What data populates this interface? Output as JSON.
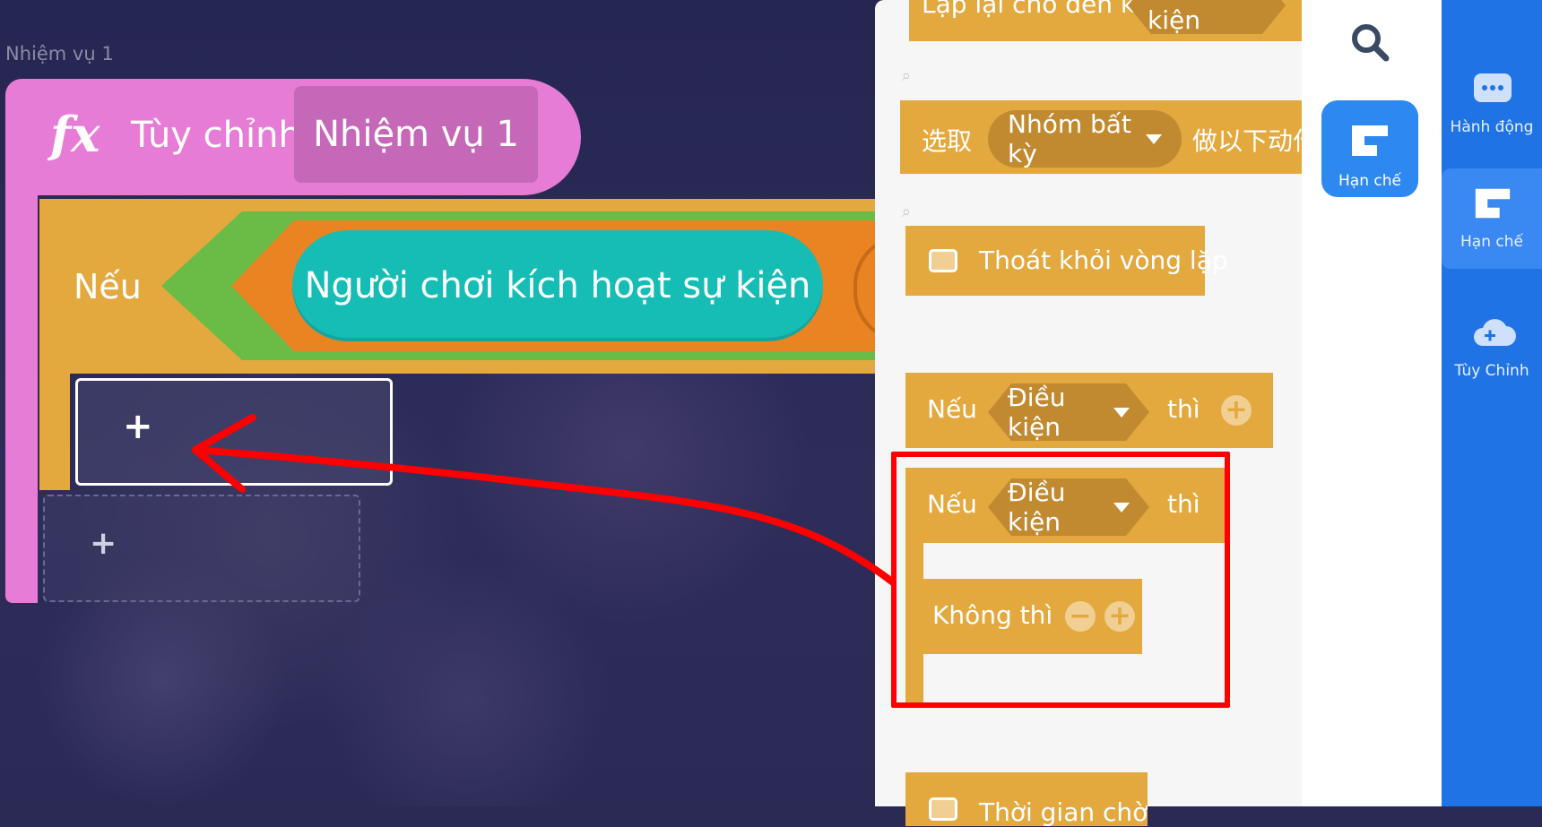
{
  "workspace": {
    "task_label": "Nhiệm vụ 1",
    "function_block": {
      "icon": "fx",
      "custom_label": "Tùy chỉnh",
      "name": "Nhiệm vụ 1"
    },
    "if_block": {
      "label": "Nếu",
      "condition": "Người chơi kích hoạt sự kiện"
    },
    "slot_plus": "+",
    "empty_slot_plus": "+"
  },
  "palette": {
    "repeat_until": {
      "text": "Lặp lại cho đến khi",
      "dropdown": "Điều kiện"
    },
    "select_block": {
      "prefix": "选取",
      "dropdown": "Nhóm bất kỳ",
      "suffix": "做以下动作"
    },
    "break_block": {
      "label": "Thoát khỏi vòng lặp"
    },
    "if_then": {
      "if": "Nếu",
      "dropdown": "Điều kiện",
      "then": "thì",
      "add": "+"
    },
    "if_else": {
      "if": "Nếu",
      "dropdown": "Điều kiện",
      "then": "thì",
      "else": "Không thì",
      "remove": "−",
      "add": "+"
    },
    "wait_block": {
      "label": "Thời gian chờ"
    }
  },
  "category_column": {
    "search_icon": "search-icon",
    "active": {
      "label": "Hạn chế",
      "icon": "control-block-icon",
      "color": "#2d88f0"
    }
  },
  "sidebar": {
    "color": "#1f73e4",
    "items": [
      {
        "label": "Hành động",
        "icon": "chat-dots-icon"
      },
      {
        "label": "Hạn chế",
        "icon": "control-block-icon",
        "selected": true
      },
      {
        "label": "Tùy Chỉnh",
        "icon": "cloud-plus-icon"
      }
    ]
  },
  "annotation": {
    "color": "#ff0000"
  }
}
